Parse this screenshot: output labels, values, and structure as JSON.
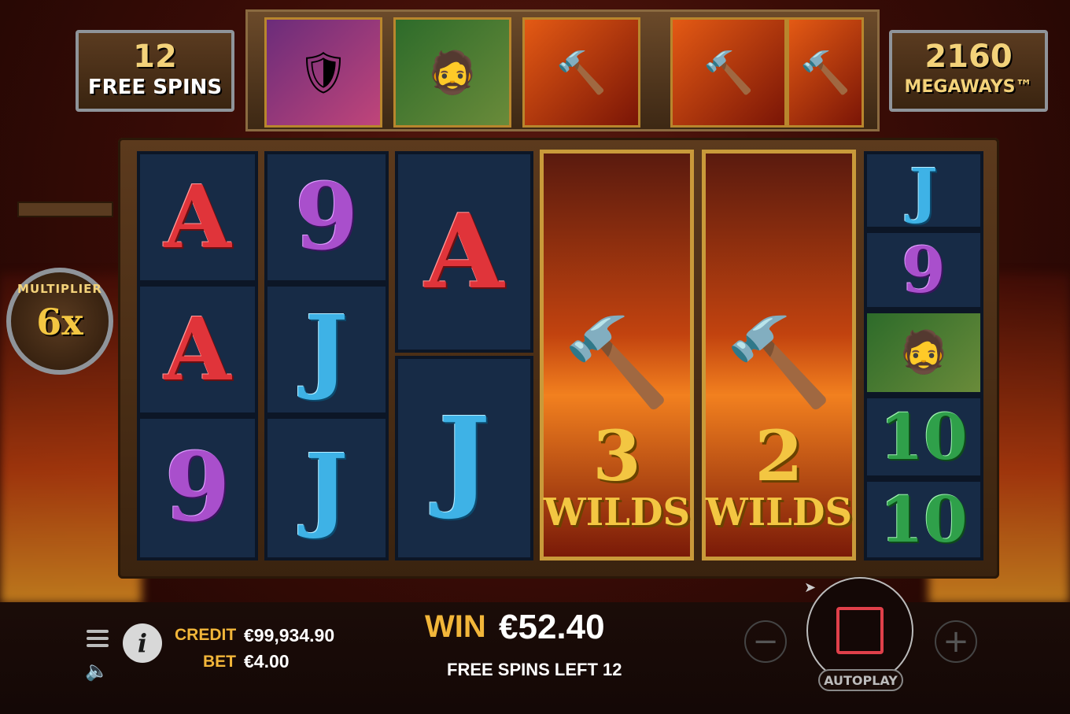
{
  "header": {
    "free_spins_count": "12",
    "free_spins_label": "FREE SPINS",
    "megaways_count": "2160",
    "megaways_label": "MEGAWAYS™"
  },
  "top_reel": {
    "symbols": [
      "viking-woman-icon",
      "dwarf-icon",
      "hammer-icon",
      "hammer-icon",
      "hammer-icon"
    ]
  },
  "multiplier": {
    "label": "MULTIPLIER",
    "value": "6x"
  },
  "reels": {
    "col1": [
      "A",
      "A",
      "9"
    ],
    "col2": [
      "9",
      "J",
      "J"
    ],
    "col3": [
      "A",
      "J"
    ],
    "wild1": {
      "count": "3",
      "label": "WILDS"
    },
    "wild2": {
      "count": "2",
      "label": "WILDS"
    },
    "col6": [
      "J",
      "9",
      "dwarf-icon",
      "10",
      "10"
    ]
  },
  "colors": {
    "red_symbol": "#e0343a",
    "purple_symbol": "#a94fcc",
    "blue_symbol": "#3eb2e6",
    "green_symbol": "#2fa04a",
    "gold_text": "#f2b63a"
  },
  "footer": {
    "credit_label": "CREDIT",
    "credit_value": "€99,934.90",
    "bet_label": "BET",
    "bet_value": "€4.00",
    "win_label": "WIN",
    "win_value": "€52.40",
    "free_spins_left": "FREE SPINS LEFT 12",
    "autoplay_label": "AUTOPLAY",
    "minus_label": "−",
    "plus_label": "+",
    "info_label": "i"
  }
}
